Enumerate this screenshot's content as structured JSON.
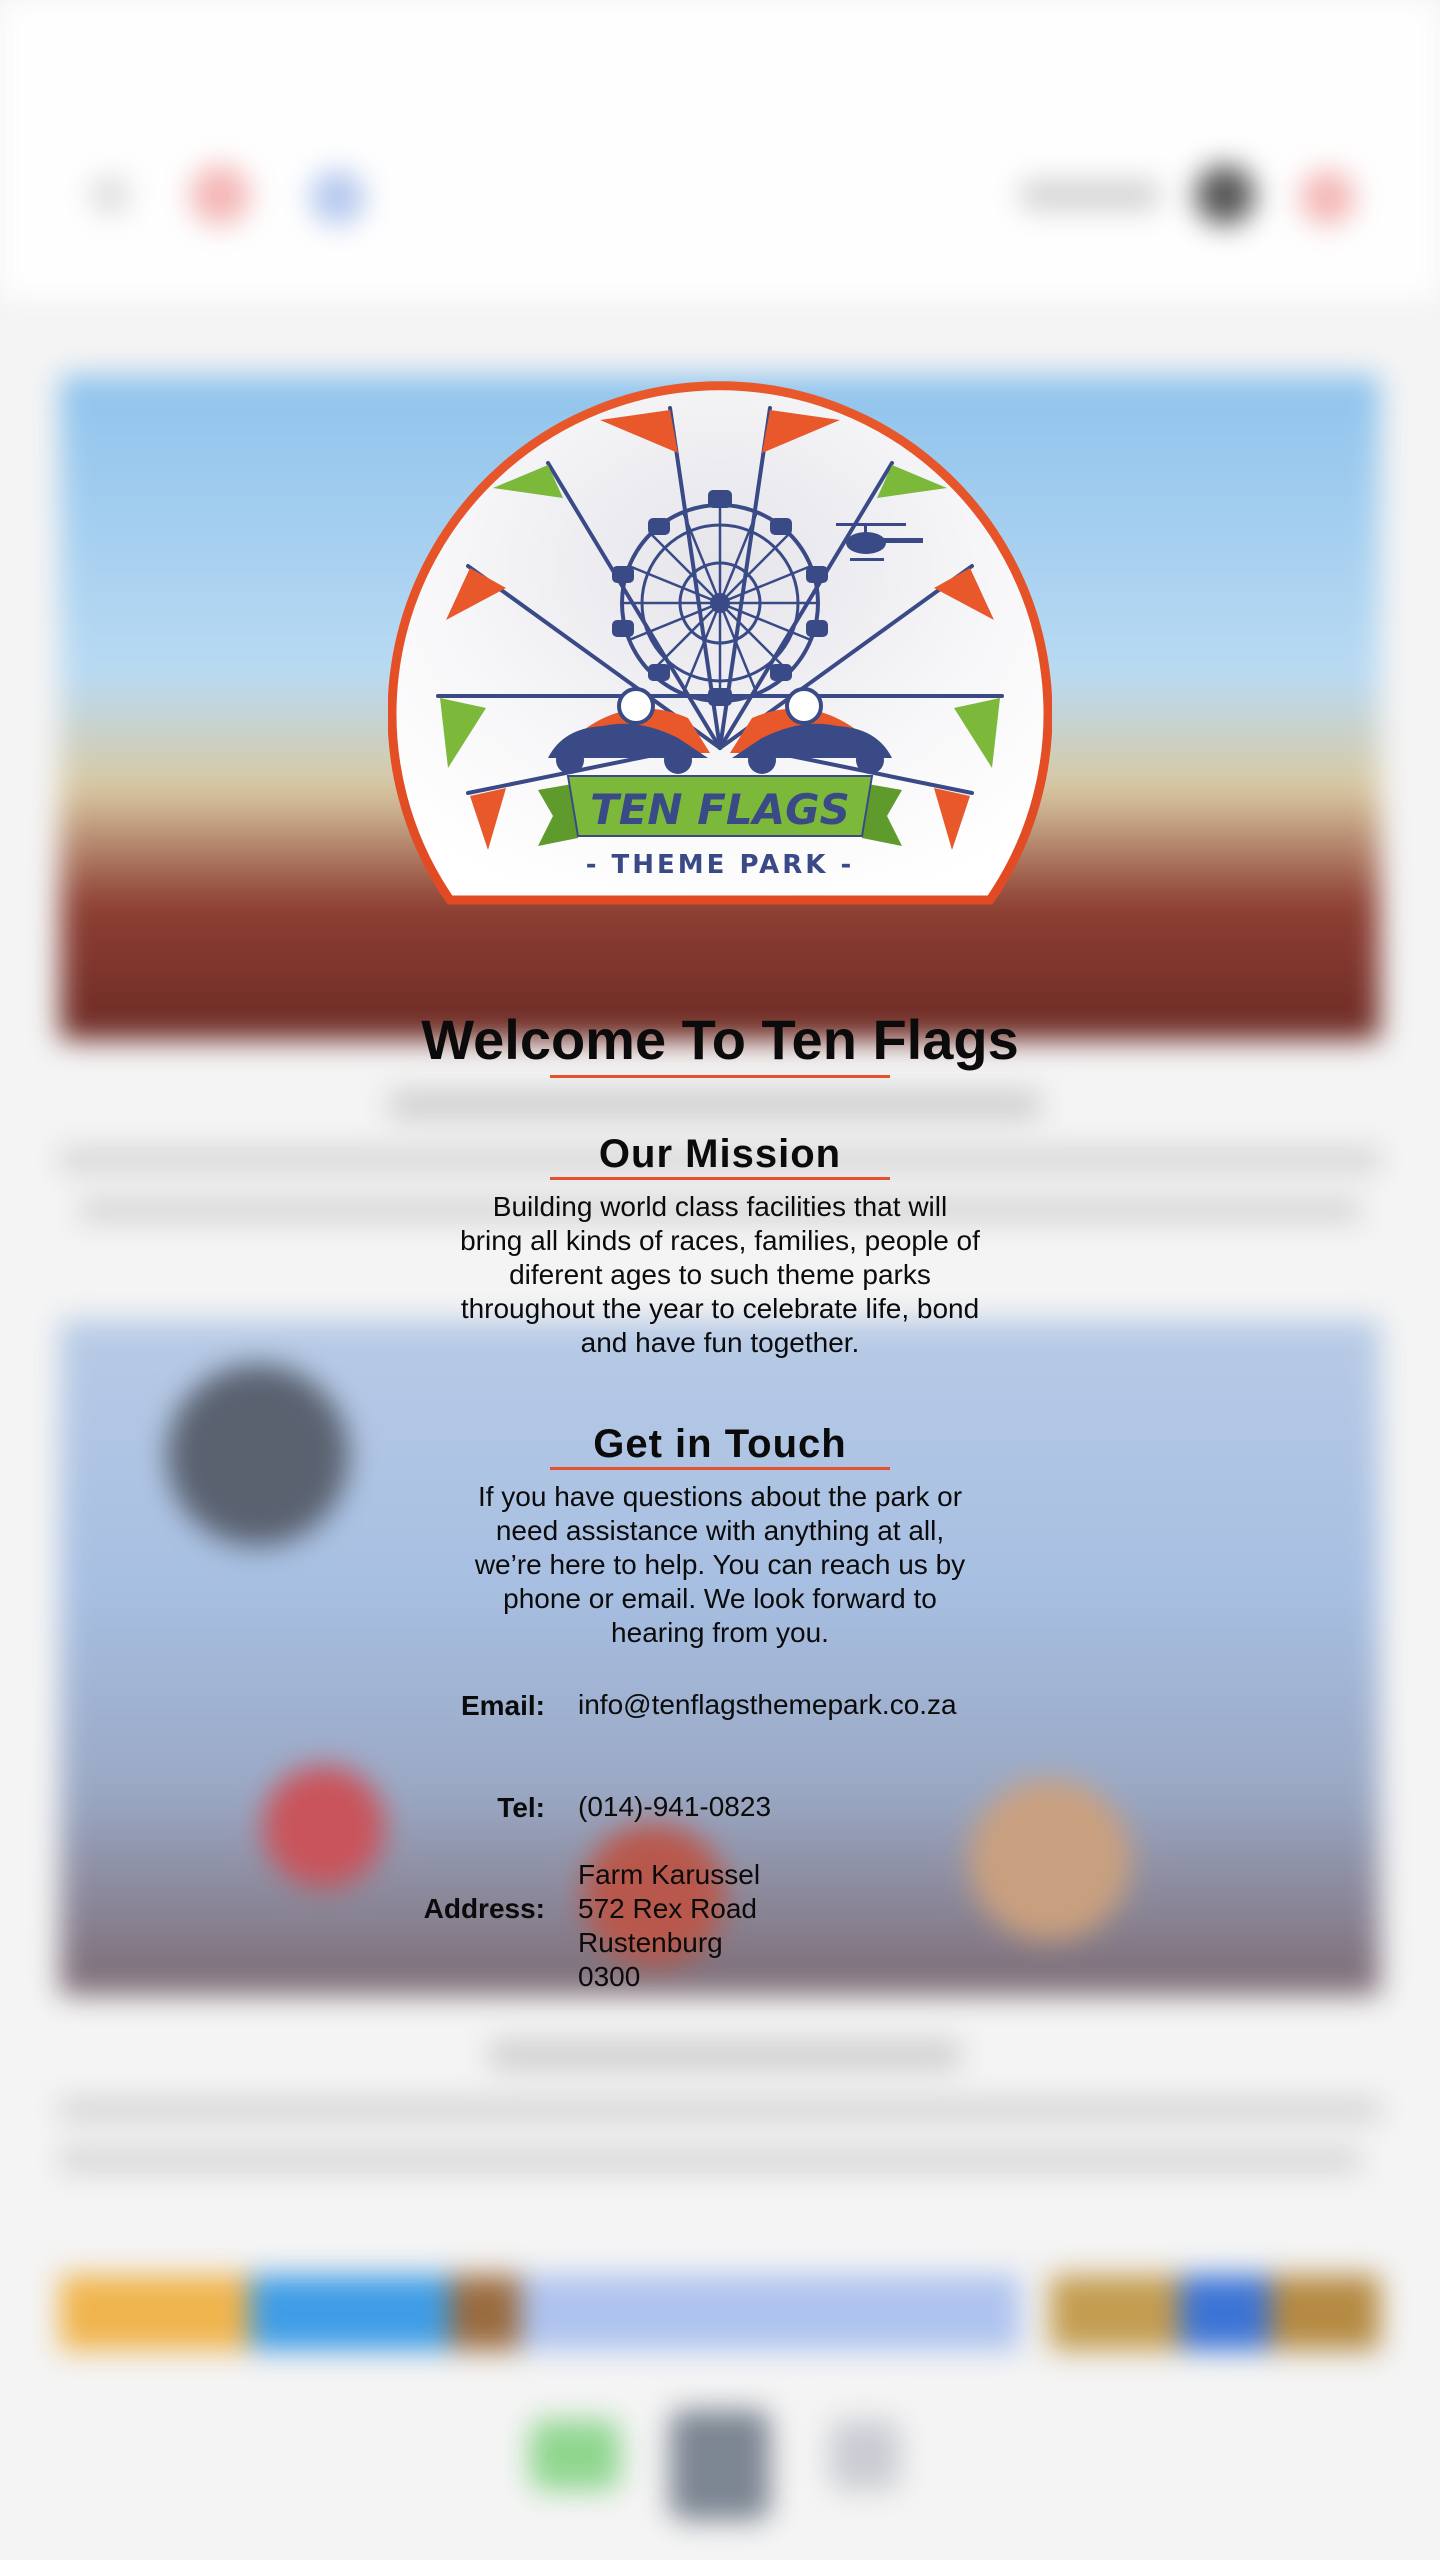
{
  "logo": {
    "name_line1": "TEN FLAGS",
    "name_line2": "- THEME PARK -"
  },
  "welcome_title": "Welcome To Ten Flags",
  "mission": {
    "title": "Our Mission",
    "text": "Building world class facilities that will bring all kinds of races, families, people of diferent ages to such theme parks throughout the year to celebrate life, bond and have fun together."
  },
  "contact": {
    "title": "Get in Touch",
    "text": "If you have questions about the park or need assistance with anything at all, we’re here to help. You can reach us by phone or email. We look forward to hearing from you.",
    "email_label": "Email:",
    "email_value": "info@tenflagsthemepark.co.za",
    "tel_label": "Tel:",
    "tel_value": "(014)-941-0823",
    "address_label": "Address:",
    "address_lines": [
      "Farm Karussel",
      "572 Rex Road",
      "Rustenburg",
      "0300"
    ]
  },
  "colors": {
    "accent": "#e5502d",
    "logo_blue": "#3a4a86",
    "logo_green": "#7cb83a",
    "logo_orange": "#e8582b"
  }
}
